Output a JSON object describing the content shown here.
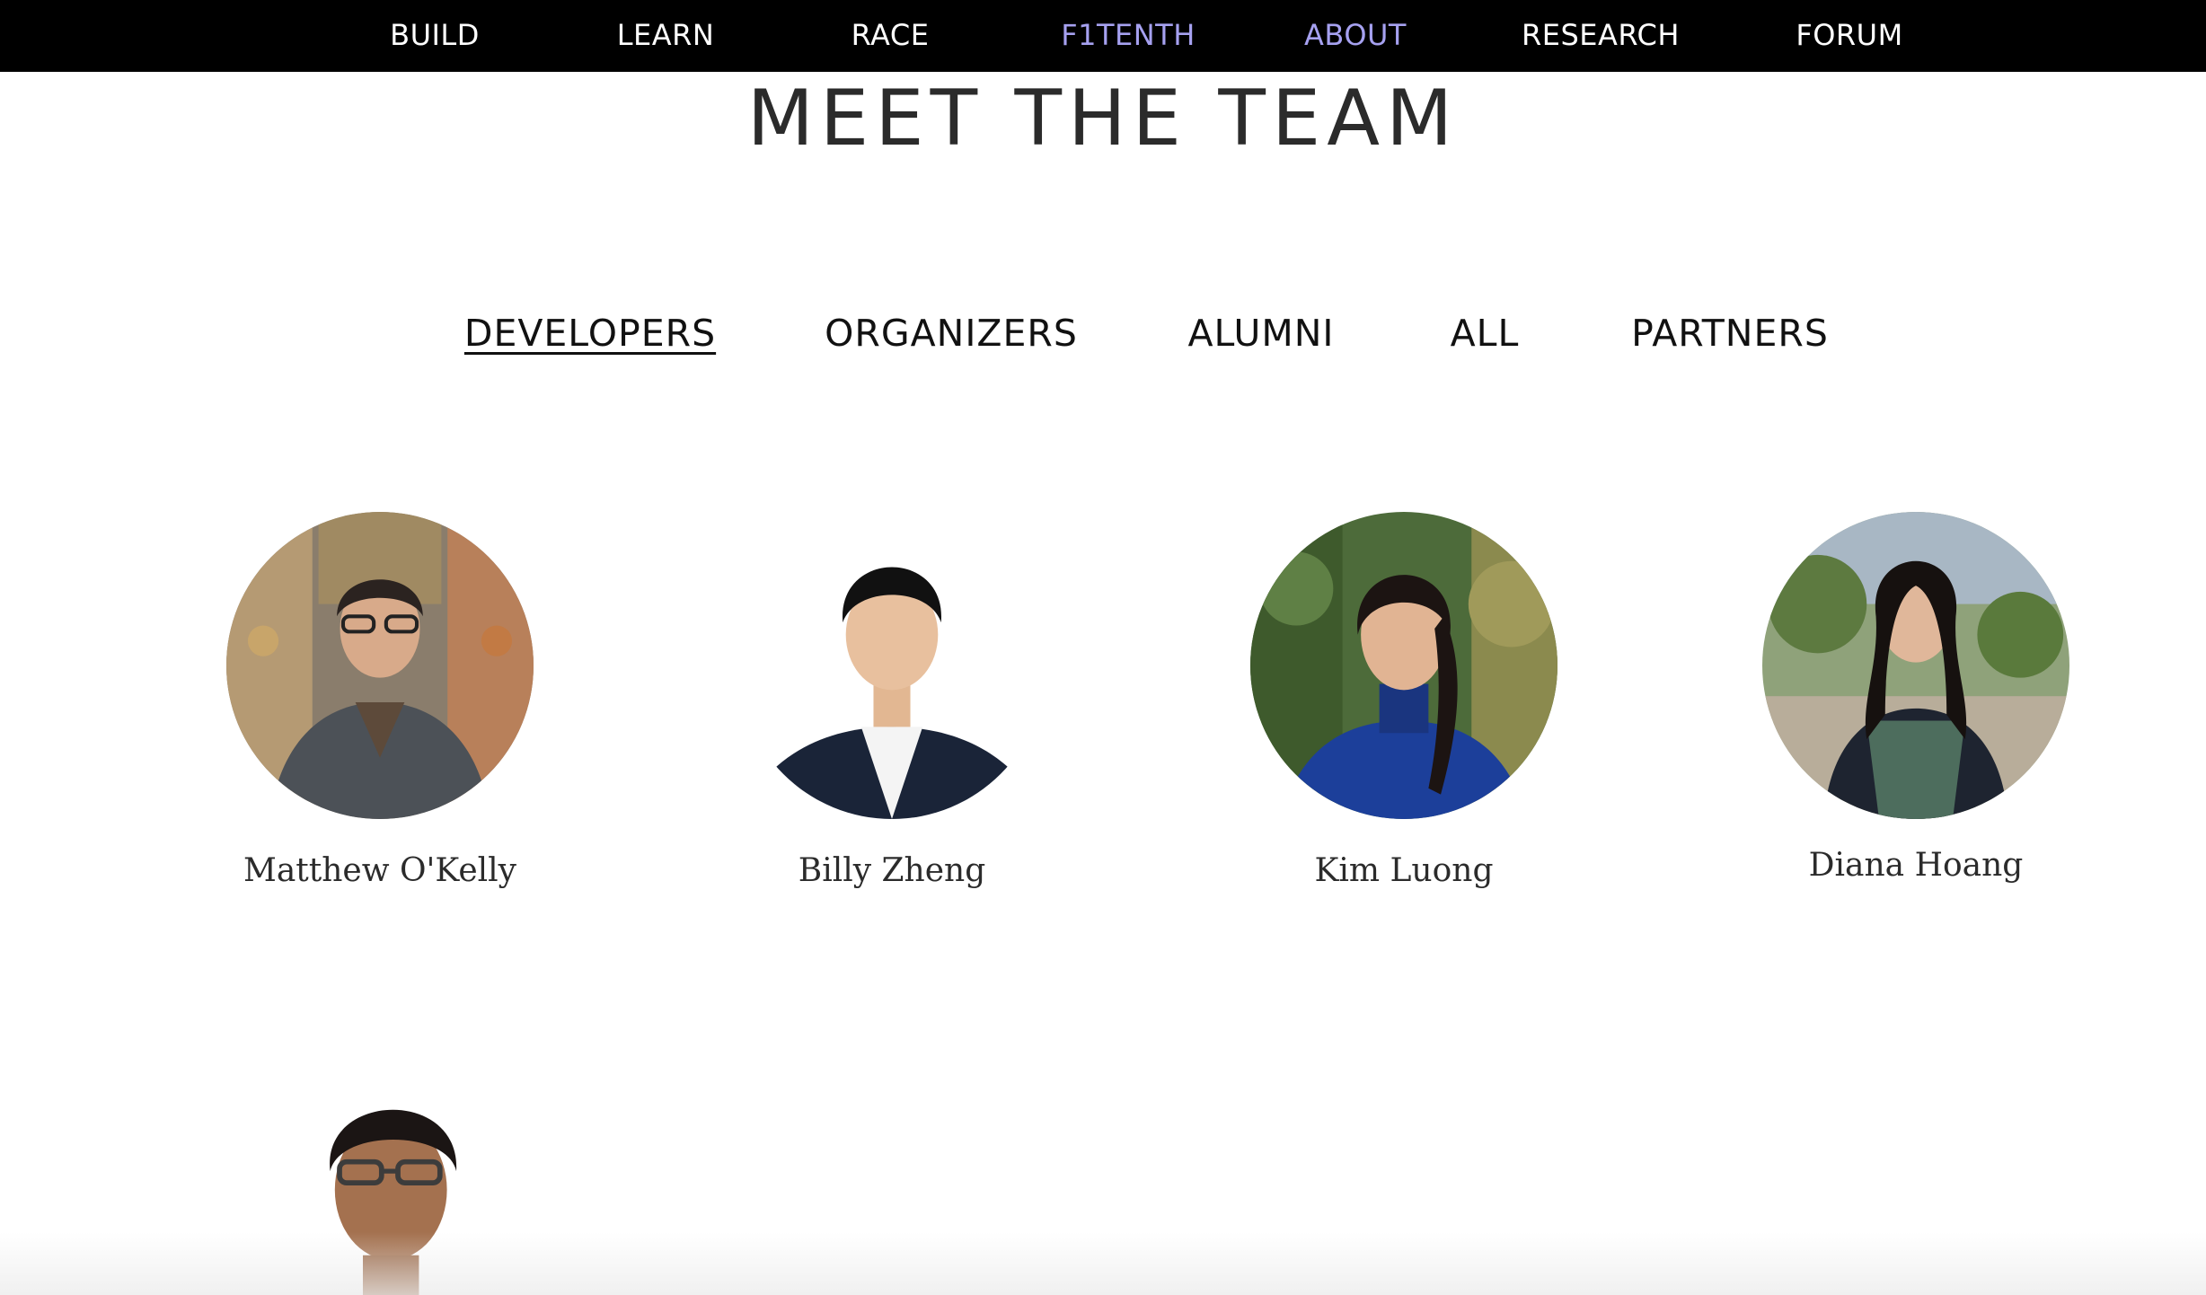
{
  "nav": {
    "items": [
      {
        "label": "BUILD",
        "active": false
      },
      {
        "label": "LEARN",
        "active": false
      },
      {
        "label": "RACE",
        "active": false
      },
      {
        "label": "F1TENTH",
        "active": true
      },
      {
        "label": "ABOUT",
        "active": true
      },
      {
        "label": "RESEARCH",
        "active": false
      },
      {
        "label": "FORUM",
        "active": false
      }
    ],
    "active_color": "#a6a1f0"
  },
  "page": {
    "title": "MEET THE TEAM"
  },
  "tabs": {
    "selected": "DEVELOPERS",
    "items": [
      "DEVELOPERS",
      "ORGANIZERS",
      "ALUMNI",
      "ALL",
      "PARTNERS"
    ]
  },
  "team": {
    "members": [
      {
        "name": "Matthew O'Kelly"
      },
      {
        "name": "Billy Zheng"
      },
      {
        "name": "Kim Luong"
      },
      {
        "name": "Diana Hoang"
      }
    ]
  }
}
